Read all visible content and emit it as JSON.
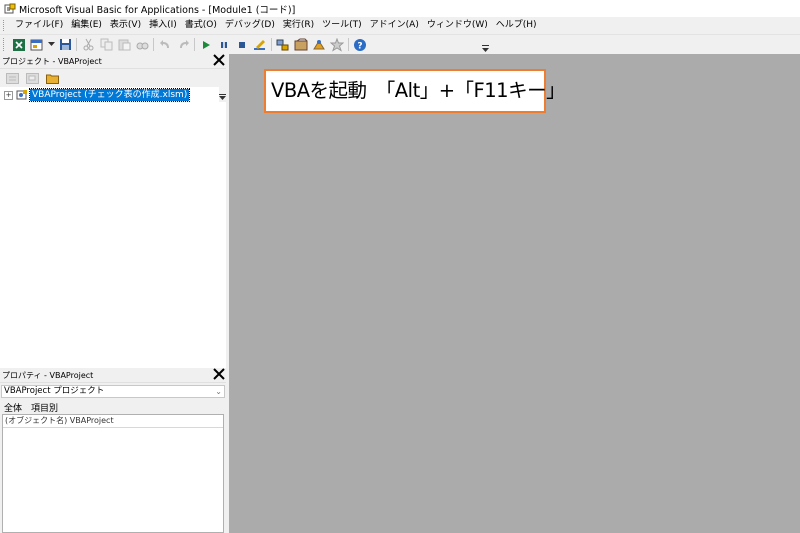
{
  "window": {
    "title": "Microsoft Visual Basic for Applications - [Module1 (コード)]",
    "app_icon": "vba-app-icon"
  },
  "menu": {
    "items": [
      {
        "label": "ファイル(F)"
      },
      {
        "label": "編集(E)"
      },
      {
        "label": "表示(V)"
      },
      {
        "label": "挿入(I)"
      },
      {
        "label": "書式(O)"
      },
      {
        "label": "デバッグ(D)"
      },
      {
        "label": "実行(R)"
      },
      {
        "label": "ツール(T)"
      },
      {
        "label": "アドイン(A)"
      },
      {
        "label": "ウィンドウ(W)"
      },
      {
        "label": "ヘルプ(H)"
      }
    ]
  },
  "toolbar": {
    "icons": [
      "excel-view-icon",
      "insert-module-icon",
      "dropdown-arrow-icon",
      "save-icon",
      "cut-icon",
      "copy-icon",
      "paste-icon",
      "find-icon",
      "undo-icon",
      "redo-icon",
      "run-icon",
      "break-icon",
      "reset-icon",
      "design-mode-icon",
      "project-explorer-icon",
      "properties-window-icon",
      "object-browser-icon",
      "toolbox-icon",
      "help-icon"
    ]
  },
  "project_panel": {
    "title": "プロジェクト - VBAProject",
    "tree": {
      "label": "VBAProject (チェック表の作成.xlsm)"
    }
  },
  "properties_panel": {
    "title": "プロパティ - VBAProject",
    "selected_object": "VBAProject プロジェクト",
    "tabs": [
      "全体",
      "項目別"
    ],
    "rows": [
      {
        "text": "(オブジェクト名) VBAProject"
      }
    ]
  },
  "annotation": {
    "text": "VBAを起動　「Alt」+「F11キー」"
  },
  "colors": {
    "accent": "#ed7d31",
    "selection": "#0078d7",
    "workspace": "#ababab"
  }
}
